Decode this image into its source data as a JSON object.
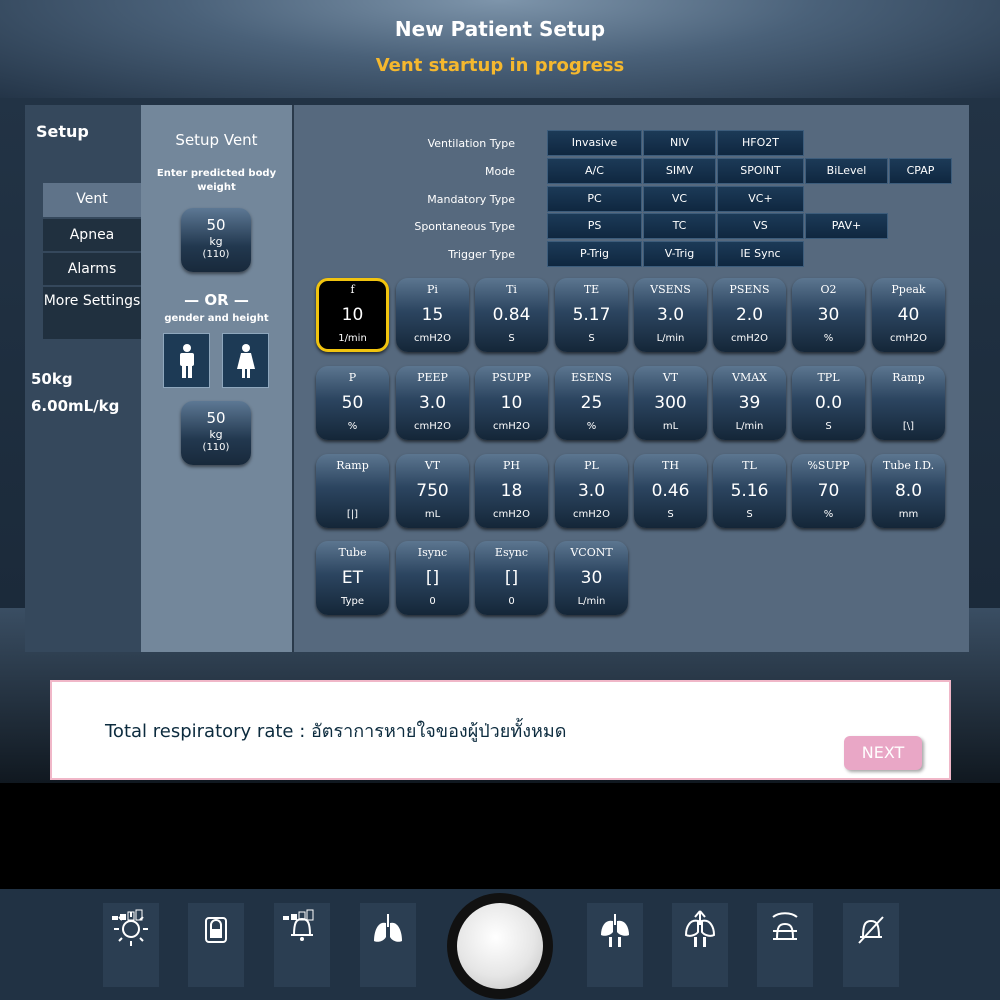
{
  "header": {
    "title": "New Patient Setup",
    "status": "Vent startup in progress",
    "status_color": "#f5b82e"
  },
  "sidebar": {
    "title": "Setup",
    "items": [
      {
        "label": "Vent",
        "active": true
      },
      {
        "label": "Apnea",
        "active": false
      },
      {
        "label": "Alarms",
        "active": false
      },
      {
        "label": "More Settings",
        "active": false
      }
    ],
    "weight_display": "50kg",
    "vt_per_kg": "6.00mL/kg"
  },
  "setup_vent": {
    "title": "Setup Vent",
    "instruction": "Enter predicted body weight",
    "weight_button": {
      "value": "50",
      "unit": "kg",
      "pounds": "(110)"
    },
    "or_label": "— OR —",
    "gender_label": "gender and height",
    "gender_buttons": [
      "male-icon",
      "female-icon"
    ],
    "height_button": {
      "value": "50",
      "unit": "kg",
      "pounds": "(110)"
    }
  },
  "options": {
    "ventilation_type": {
      "label": "Ventilation Type",
      "items": [
        "Invasive",
        "NIV",
        "HFO2T"
      ]
    },
    "mode": {
      "label": "Mode",
      "items": [
        "A/C",
        "SIMV",
        "SPOINT",
        "BiLevel",
        "CPAP"
      ]
    },
    "mandatory_type": {
      "label": "Mandatory Type",
      "items": [
        "PC",
        "VC",
        "VC+"
      ]
    },
    "spontaneous_type": {
      "label": "Spontaneous Type",
      "items": [
        "PS",
        "TC",
        "VS",
        "PAV+"
      ]
    },
    "trigger_type": {
      "label": "Trigger Type",
      "items": [
        "P-Trig",
        "V-Trig",
        "IE Sync"
      ]
    }
  },
  "params": [
    {
      "name": "f",
      "value": "10",
      "unit": "1/min",
      "selected": true
    },
    {
      "name": "Pi",
      "value": "15",
      "unit": "cmH2O"
    },
    {
      "name": "Ti",
      "value": "0.84",
      "unit": "S"
    },
    {
      "name": "TE",
      "value": "5.17",
      "unit": "S"
    },
    {
      "name": "VSENS",
      "value": "3.0",
      "unit": "L/min"
    },
    {
      "name": "PSENS",
      "value": "2.0",
      "unit": "cmH2O"
    },
    {
      "name": "O2",
      "value": "30",
      "unit": "%"
    },
    {
      "name": "Ppeak",
      "value": "40",
      "unit": "cmH2O"
    },
    {
      "name": "P",
      "value": "50",
      "unit": "%"
    },
    {
      "name": "PEEP",
      "value": "3.0",
      "unit": "cmH2O"
    },
    {
      "name": "PSUPP",
      "value": "10",
      "unit": "cmH2O"
    },
    {
      "name": "ESENS",
      "value": "25",
      "unit": "%"
    },
    {
      "name": "VT",
      "value": "300",
      "unit": "mL"
    },
    {
      "name": "VMAX",
      "value": "39",
      "unit": "L/min"
    },
    {
      "name": "TPL",
      "value": "0.0",
      "unit": "S"
    },
    {
      "name": "Ramp",
      "value": "",
      "unit": "[\\]"
    },
    {
      "name": "Ramp",
      "value": "",
      "unit": "[|]"
    },
    {
      "name": "VT",
      "value": "750",
      "unit": "mL"
    },
    {
      "name": "PH",
      "value": "18",
      "unit": "cmH2O"
    },
    {
      "name": "PL",
      "value": "3.0",
      "unit": "cmH2O"
    },
    {
      "name": "TH",
      "value": "0.46",
      "unit": "S"
    },
    {
      "name": "TL",
      "value": "5.16",
      "unit": "S"
    },
    {
      "name": "%SUPP",
      "value": "70",
      "unit": "%"
    },
    {
      "name": "Tube I.D.",
      "value": "8.0",
      "unit": "mm"
    },
    {
      "name": "Tube",
      "value": "ET",
      "unit": "Type"
    },
    {
      "name": "Isync",
      "value": "[]",
      "unit": "0"
    },
    {
      "name": "Esync",
      "value": "[]",
      "unit": "0"
    },
    {
      "name": "VCONT",
      "value": "30",
      "unit": "L/min"
    }
  ],
  "message": {
    "text": "Total respiratory rate : อัตราการหายใจของผู้ป่วยทั้งหมด",
    "next_label": "NEXT",
    "next_color": "#e9a7c6"
  },
  "bottom_bar": {
    "icons": [
      "brightness-icon",
      "lock-icon",
      "alarm-volume-icon",
      "lungs-icon",
      "manual-inspiration-icon",
      "expiratory-pause-icon",
      "alarm-reset-icon",
      "alarm-silence-icon"
    ],
    "knob": "control-knob"
  }
}
